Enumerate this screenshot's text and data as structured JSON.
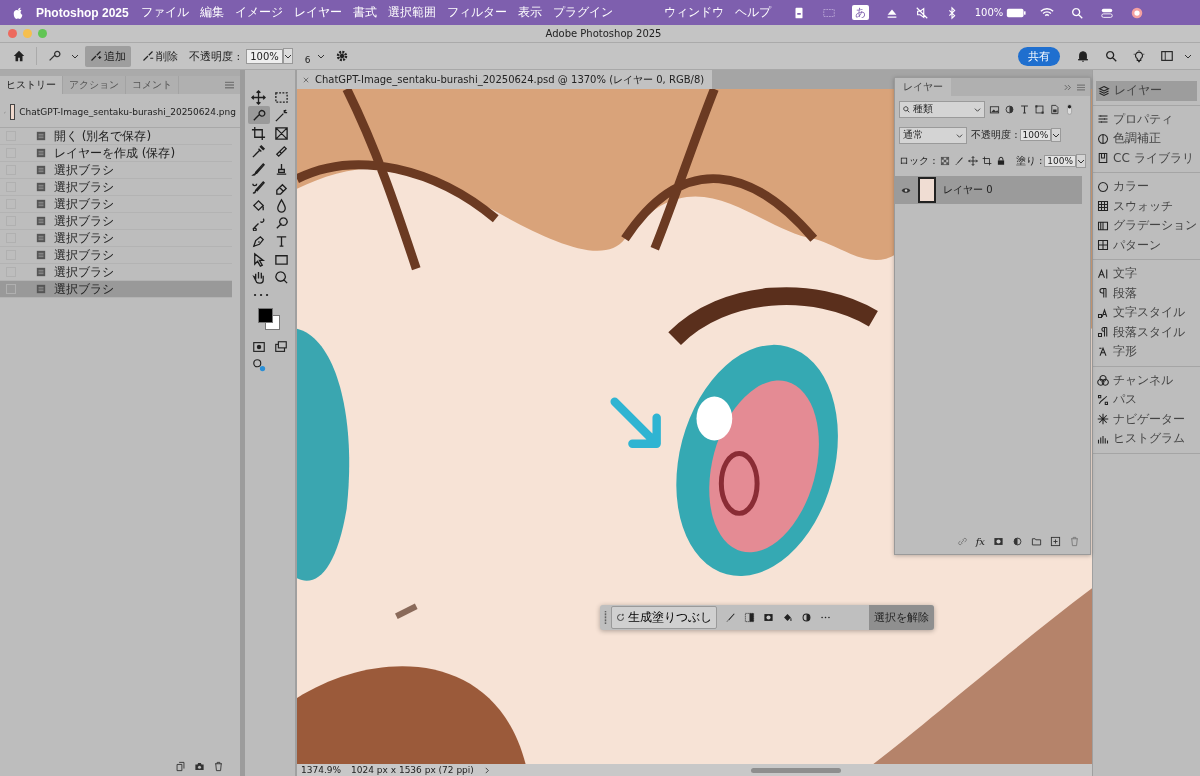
{
  "menu_bar": {
    "app_name": "Photoshop 2025",
    "items": [
      "ファイル",
      "編集",
      "イメージ",
      "レイヤー",
      "書式",
      "選択範囲",
      "フィルター",
      "表示",
      "プラグイン"
    ],
    "items_right": [
      "ウィンドウ",
      "ヘルプ"
    ],
    "input_mode": "あ",
    "battery": "100%"
  },
  "window": {
    "title": "Adobe Photoshop 2025"
  },
  "options_bar": {
    "modes": [
      {
        "kind": "add",
        "label": "追加",
        "selected": true
      },
      {
        "kind": "remove",
        "label": "削除",
        "selected": false
      }
    ],
    "opacity_label": "不透明度 :",
    "opacity": "100%",
    "brush_size": "6",
    "share_button": "共有"
  },
  "history_panel": {
    "tabs": [
      {
        "label": "ヒストリー",
        "selected": true
      },
      {
        "label": "アクション",
        "selected": false
      },
      {
        "label": "コメント",
        "selected": false
      }
    ],
    "snapshot": {
      "name": "ChatGPT-Image_sentaku-burashi_20250624.png"
    },
    "steps": [
      {
        "label": "開く (別名で保存)",
        "selected": false
      },
      {
        "label": "レイヤーを作成 (保存)",
        "selected": false
      },
      {
        "label": "選択ブラシ",
        "selected": false
      },
      {
        "label": "選択ブラシ",
        "selected": false
      },
      {
        "label": "選択ブラシ",
        "selected": false
      },
      {
        "label": "選択ブラシ",
        "selected": false
      },
      {
        "label": "選択ブラシ",
        "selected": false
      },
      {
        "label": "選択ブラシ",
        "selected": false
      },
      {
        "label": "選択ブラシ",
        "selected": false
      },
      {
        "label": "選択ブラシ",
        "selected": true
      }
    ]
  },
  "tools": [
    {
      "kind": "move",
      "selected": false
    },
    {
      "kind": "marquee",
      "selected": false
    },
    {
      "kind": "quick",
      "selected": true
    },
    {
      "kind": "wand",
      "selected": false
    },
    {
      "kind": "crop",
      "selected": false
    },
    {
      "kind": "frame",
      "selected": false
    },
    {
      "kind": "eyedropper",
      "selected": false
    },
    {
      "kind": "bandage",
      "selected": false
    },
    {
      "kind": "brush",
      "selected": false
    },
    {
      "kind": "stamp",
      "selected": false
    },
    {
      "kind": "historybrush",
      "selected": false
    },
    {
      "kind": "eraser",
      "selected": false
    },
    {
      "kind": "bucket",
      "selected": false
    },
    {
      "kind": "drop",
      "selected": false
    },
    {
      "kind": "replace",
      "selected": false
    },
    {
      "kind": "dodge",
      "selected": false
    },
    {
      "kind": "pen",
      "selected": false
    },
    {
      "kind": "type",
      "selected": false
    },
    {
      "kind": "pointer",
      "selected": false
    },
    {
      "kind": "rect",
      "selected": false
    },
    {
      "kind": "hand",
      "selected": false
    },
    {
      "kind": "zoom",
      "selected": false
    }
  ],
  "document": {
    "tab_title": "ChatGPT-Image_sentaku-burashi_20250624.psd @ 1370% (レイヤー 0, RGB/8)",
    "zoom": "1374.9%",
    "size_info": "1024 px x 1536 px (72 ppi)"
  },
  "layers_panel": {
    "tab": "レイヤー",
    "filter": "種類",
    "blend_mode": "通常",
    "opacity_label": "不透明度 :",
    "opacity": "100%",
    "lock_label": "ロック :",
    "fill_label": "塗り :",
    "fill": "100%",
    "effects_button": "fx",
    "layers": [
      {
        "name": "レイヤー 0",
        "visible": true,
        "selected": true
      }
    ]
  },
  "dock": {
    "groups": [
      [
        {
          "kind": "layers",
          "label": "レイヤー",
          "selected": true
        }
      ],
      [
        {
          "kind": "properties",
          "label": "プロパティ",
          "selected": false
        },
        {
          "kind": "adjust",
          "label": "色調補正",
          "selected": false
        },
        {
          "kind": "library",
          "label": "CC ライブラリ",
          "selected": false
        }
      ],
      [
        {
          "kind": "color",
          "label": "カラー",
          "selected": false
        },
        {
          "kind": "swatches",
          "label": "スウォッチ",
          "selected": false
        },
        {
          "kind": "gradient",
          "label": "グラデーション",
          "selected": false
        },
        {
          "kind": "pattern",
          "label": "パターン",
          "selected": false
        }
      ],
      [
        {
          "kind": "character",
          "label": "文字",
          "selected": false
        },
        {
          "kind": "paragraph",
          "label": "段落",
          "selected": false
        },
        {
          "kind": "charstyle",
          "label": "文字スタイル",
          "selected": false
        },
        {
          "kind": "parastyle",
          "label": "段落スタイル",
          "selected": false
        },
        {
          "kind": "glyph",
          "label": "字形",
          "selected": false
        }
      ],
      [
        {
          "kind": "channels",
          "label": "チャンネル",
          "selected": false
        },
        {
          "kind": "paths",
          "label": "パス",
          "selected": false
        },
        {
          "kind": "navigator",
          "label": "ナビゲーター",
          "selected": false
        },
        {
          "kind": "histogram",
          "label": "ヒストグラム",
          "selected": false
        }
      ]
    ]
  },
  "task_bar": {
    "generative_fill": "生成塗りつぶし",
    "deselect": "選択を解除"
  }
}
